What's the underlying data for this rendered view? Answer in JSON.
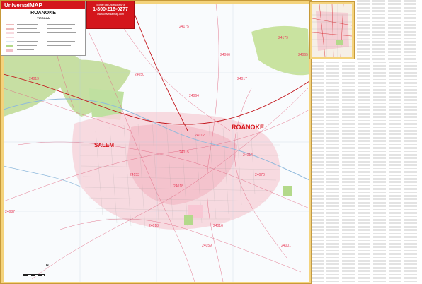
{
  "brand": "UniversalMAP",
  "city_title": "ROANOKE",
  "state_title": "VIRGINIA",
  "promo": {
    "small": "To order call UniversalMAP at",
    "phone": "1-800-216-0277",
    "url": "www.universalmap.com"
  },
  "places": {
    "roanoke": "ROANOKE",
    "salem": "SALEM"
  },
  "zips": [
    "24175",
    "24019",
    "24012",
    "24153",
    "24018",
    "24014",
    "24015",
    "24016",
    "24017",
    "24179",
    "24066",
    "24087",
    "24018",
    "24001",
    "24065",
    "24064",
    "24070",
    "24059",
    "24050"
  ],
  "north_label": "N",
  "colors": {
    "frame": "#f4d37c",
    "brand_red": "#d4161c",
    "urban": "#f2c0c8",
    "parks": "#b3d98a",
    "water": "#8fb9dc"
  }
}
